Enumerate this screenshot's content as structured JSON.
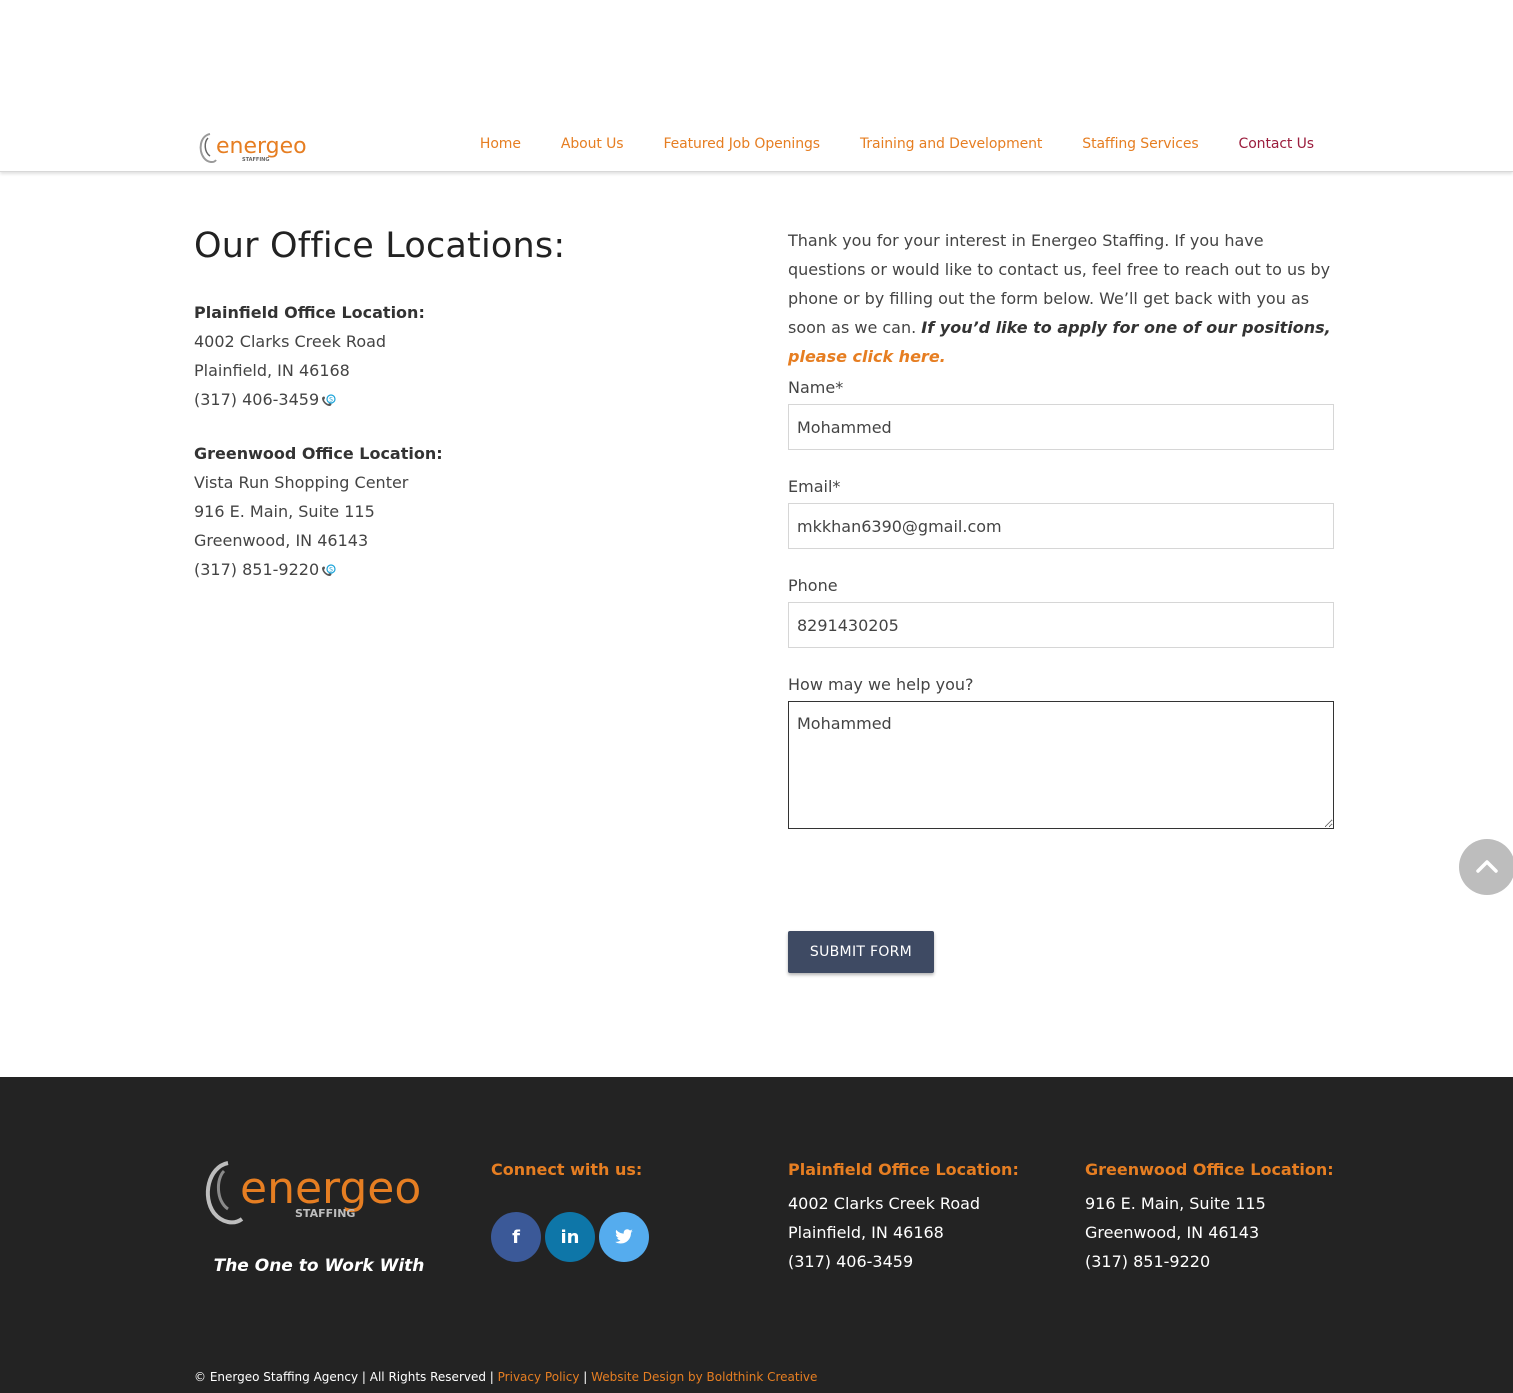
{
  "brand": {
    "logo_name": "energeo",
    "logo_sub": "STAFFING",
    "tagline": "The One to Work With",
    "accent_color": "#e67e22",
    "active_color": "#9b1d3d"
  },
  "nav": {
    "items": [
      {
        "label": "Home"
      },
      {
        "label": "About Us"
      },
      {
        "label": "Featured Job Openings"
      },
      {
        "label": "Training and Development"
      },
      {
        "label": "Staffing Services"
      },
      {
        "label": "Contact Us"
      }
    ]
  },
  "main": {
    "title": "Our Office Locations:",
    "offices": [
      {
        "title": "Plainfield Office Location:",
        "lines": [
          "4002 Clarks Creek Road",
          "Plainfield, IN 46168"
        ],
        "phone": "(317) 406-3459"
      },
      {
        "title": "Greenwood Office Location:",
        "lines": [
          "Vista Run Shopping Center",
          "916 E. Main, Suite 115",
          "Greenwood, IN 46143"
        ],
        "phone": "(317) 851-9220"
      }
    ]
  },
  "contact": {
    "intro_text": "Thank you for your interest in Energeo Staffing. If you have questions or would like to contact us, feel free to reach out to us by phone or by filling out the form below. We’ll get back with you as soon as we can. ",
    "intro_bold": "If you’d like to apply for one of our positions, ",
    "intro_link": "please click here.",
    "form": {
      "name_label": "Name*",
      "name_value": "Mohammed",
      "email_label": "Email*",
      "email_value": "mkkhan6390@gmail.com",
      "phone_label": "Phone",
      "phone_value": "8291430205",
      "message_label": "How may we help you?",
      "message_value": "Mohammed",
      "submit_label": "SUBMIT FORM"
    }
  },
  "footer": {
    "connect_heading": "Connect with us:",
    "social": [
      {
        "label": "f",
        "icon": "facebook-icon"
      },
      {
        "label": "in",
        "icon": "linkedin-icon"
      },
      {
        "label": "twitter",
        "icon": "twitter-icon"
      }
    ],
    "plainfield": {
      "heading": "Plainfield Office Location:",
      "line1": "4002 Clarks Creek Road",
      "line2": "Plainfield, IN 46168",
      "phone": "(317) 406-3459"
    },
    "greenwood": {
      "heading": "Greenwood Office Location:",
      "line1": "916 E. Main, Suite 115",
      "line2": "Greenwood, IN 46143",
      "phone": "(317) 851-9220"
    },
    "copyright": "© Energeo Staffing Agency | All Rights Reserved | ",
    "privacy_label": "Privacy Policy",
    "separator": " | ",
    "design_label": "Website Design by Boldthink Creative"
  }
}
